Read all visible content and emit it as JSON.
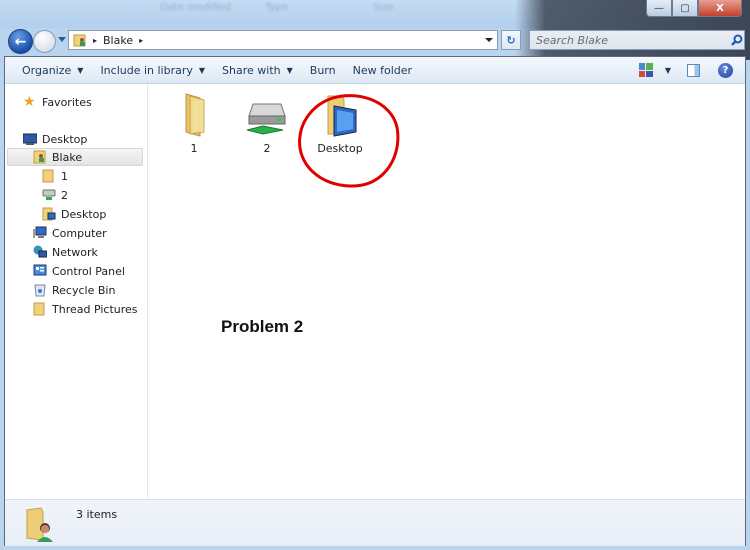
{
  "titlebar": {
    "background_column_headers": [
      "Date modified",
      "Type",
      "Size"
    ],
    "minimize_label": "—",
    "maximize_label": "▢",
    "close_label": "X"
  },
  "navigation": {
    "back_icon": "←",
    "breadcrumb": [
      {
        "label": "Blake"
      }
    ],
    "breadcrumb_sep": "▸",
    "refresh_icon": "↻",
    "search_placeholder": "Search Blake",
    "search_value": "",
    "search_icon": "⌕"
  },
  "toolbar": {
    "organize": "Organize",
    "include_in_library": "Include in library",
    "share_with": "Share with",
    "burn": "Burn",
    "new_folder": "New folder",
    "caret": "▼",
    "help_icon": "?"
  },
  "sidebar": {
    "favorites": "Favorites",
    "items": [
      {
        "label": "Desktop",
        "icon": "desktop-icon",
        "level": 0
      },
      {
        "label": "Blake",
        "icon": "user-folder-icon",
        "level": 1,
        "selected": true
      },
      {
        "label": "1",
        "icon": "folder-icon",
        "level": 2
      },
      {
        "label": "2",
        "icon": "network-drive-icon",
        "level": 2
      },
      {
        "label": "Desktop",
        "icon": "desktop-folder-icon",
        "level": 2
      },
      {
        "label": "Computer",
        "icon": "computer-icon",
        "level": 1
      },
      {
        "label": "Network",
        "icon": "network-icon",
        "level": 1
      },
      {
        "label": "Control Panel",
        "icon": "control-panel-icon",
        "level": 1
      },
      {
        "label": "Recycle Bin",
        "icon": "recycle-bin-icon",
        "level": 1
      },
      {
        "label": "Thread Pictures",
        "icon": "folder-icon",
        "level": 1
      }
    ]
  },
  "content": {
    "files": [
      {
        "name": "1",
        "icon": "folder-icon"
      },
      {
        "name": "2",
        "icon": "network-drive-icon"
      },
      {
        "name": "Desktop",
        "icon": "desktop-folder-icon"
      }
    ],
    "annotation": "Problem 2",
    "annotation_color": "#e10000"
  },
  "statusbar": {
    "item_count": "3 items"
  }
}
